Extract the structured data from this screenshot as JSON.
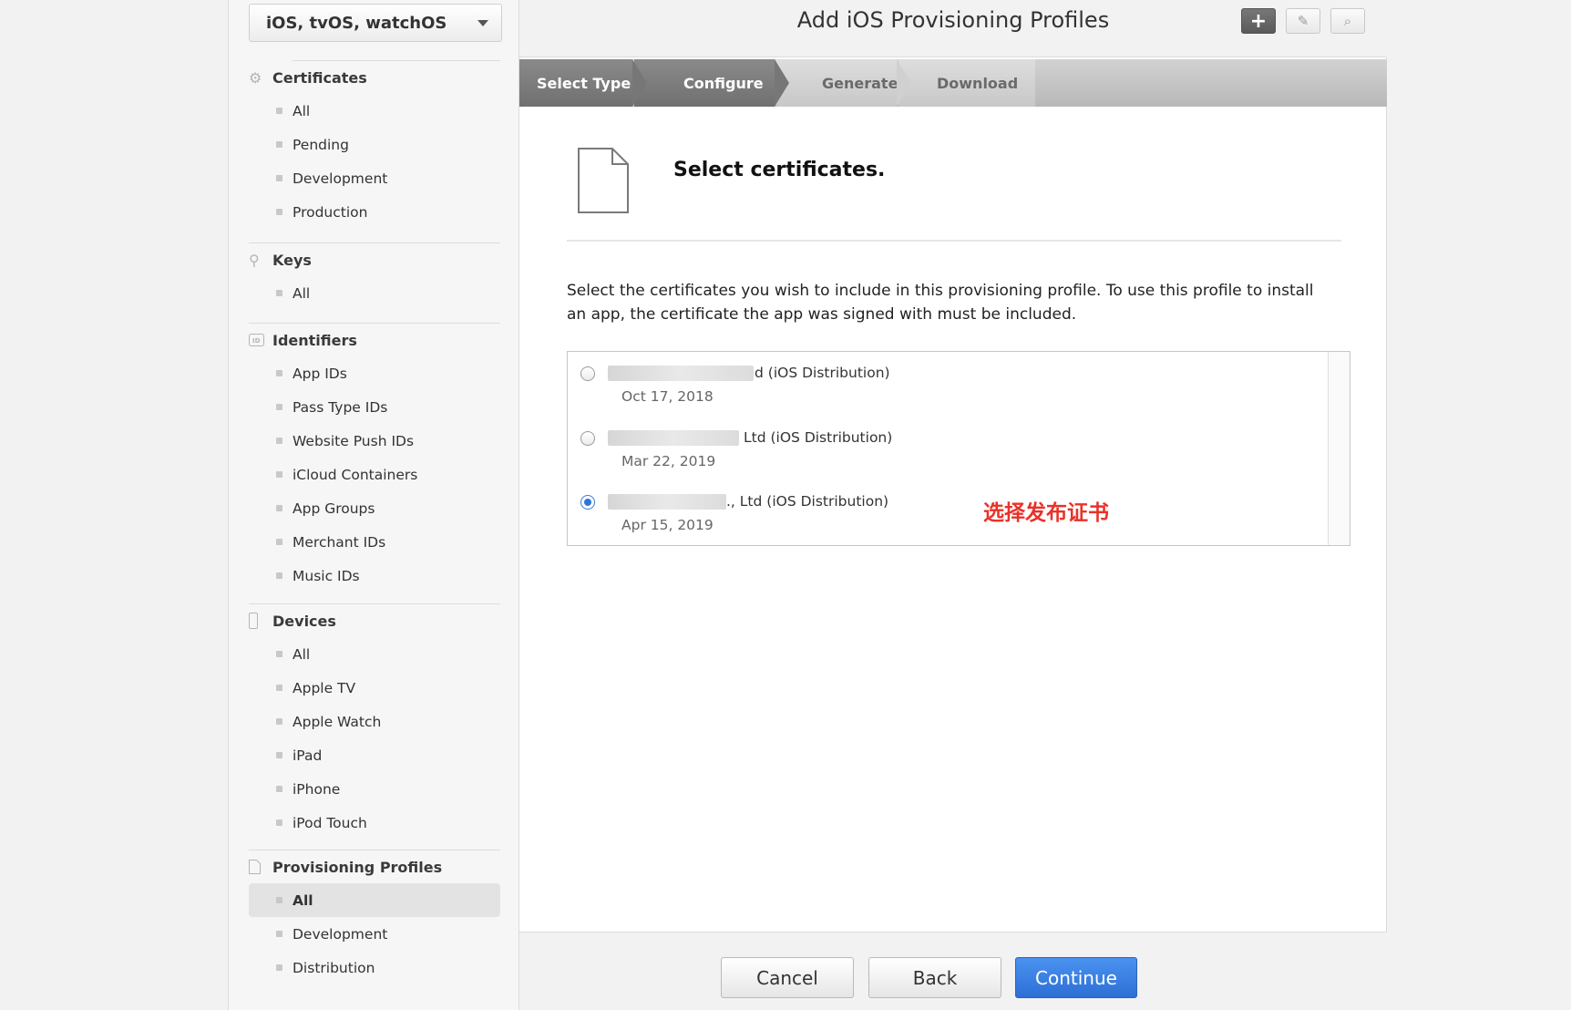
{
  "sidebar": {
    "platform": "iOS, tvOS, watchOS",
    "sections": [
      {
        "title": "Certificates",
        "icon": "gear-badge-icon",
        "items": [
          "All",
          "Pending",
          "Development",
          "Production"
        ]
      },
      {
        "title": "Keys",
        "icon": "key-icon",
        "items": [
          "All"
        ]
      },
      {
        "title": "Identifiers",
        "icon": "id-badge-icon",
        "items": [
          "App IDs",
          "Pass Type IDs",
          "Website Push IDs",
          "iCloud Containers",
          "App Groups",
          "Merchant IDs",
          "Music IDs"
        ]
      },
      {
        "title": "Devices",
        "icon": "device-icon",
        "items": [
          "All",
          "Apple TV",
          "Apple Watch",
          "iPad",
          "iPhone",
          "iPod Touch"
        ]
      },
      {
        "title": "Provisioning Profiles",
        "icon": "document-icon",
        "items": [
          "All",
          "Development",
          "Distribution"
        ],
        "active": "All"
      }
    ]
  },
  "header": {
    "title": "Add iOS Provisioning Profiles",
    "add_glyph": "+",
    "edit_glyph": "✎",
    "search_glyph": "⌕"
  },
  "steps": [
    {
      "label": "Select Type",
      "state": "done"
    },
    {
      "label": "Configure",
      "state": "done"
    },
    {
      "label": "Generate",
      "state": "todo"
    },
    {
      "label": "Download",
      "state": "todo"
    }
  ],
  "content": {
    "title": "Select certificates.",
    "description": "Select the certificates you wish to include in this provisioning profile. To use this profile to install an app, the certificate the app was signed with must be included.",
    "certificates": [
      {
        "name_suffix": "d",
        "type": "(iOS Distribution)",
        "date": "Oct 17, 2018",
        "selected": false
      },
      {
        "name_suffix": "Ltd",
        "type": "(iOS Distribution)",
        "date": "Mar 22, 2019",
        "selected": false
      },
      {
        "name_suffix": "., Ltd",
        "type": "(iOS Distribution)",
        "date": "Apr 15, 2019",
        "selected": true
      }
    ],
    "annotation": "选择发布证书"
  },
  "footer": {
    "cancel": "Cancel",
    "back": "Back",
    "continue": "Continue"
  },
  "colors": {
    "accent": "#2f74d8",
    "annotation": "#e8322a"
  }
}
